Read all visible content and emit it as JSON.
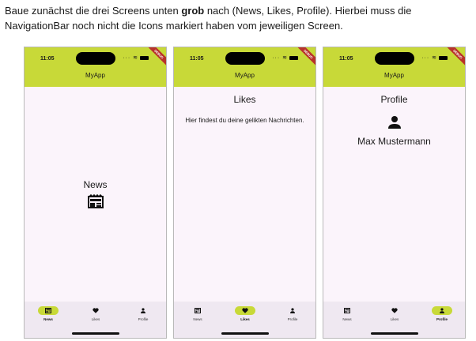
{
  "instruction": {
    "part1": "Baue zunächst die drei Screens unten ",
    "bold": "grob",
    "part2": " nach (News, Likes, Profile). Hierbei muss die NavigationBar noch nicht die Icons markiert haben vom jeweiligen Screen."
  },
  "phones": [
    {
      "status_time": "11:05",
      "debug_banner": "DEBUG",
      "app_title": "MyApp",
      "screen_title": "News",
      "screen_icon": "newspaper-icon",
      "nav": [
        {
          "label": "News",
          "icon": "newspaper-icon",
          "active": true
        },
        {
          "label": "Likes",
          "icon": "heart-icon",
          "active": false
        },
        {
          "label": "Profile",
          "icon": "person-icon",
          "active": false
        }
      ]
    },
    {
      "status_time": "11:05",
      "debug_banner": "DEBUG",
      "app_title": "MyApp",
      "screen_title": "Likes",
      "screen_text": "Hier findest du deine gelikten Nachrichten.",
      "nav": [
        {
          "label": "News",
          "icon": "newspaper-icon",
          "active": false
        },
        {
          "label": "Likes",
          "icon": "heart-icon",
          "active": true
        },
        {
          "label": "Profile",
          "icon": "person-icon",
          "active": false
        }
      ]
    },
    {
      "status_time": "11:05",
      "debug_banner": "DEBUG",
      "app_title": "MyApp",
      "screen_title": "Profile",
      "screen_icon": "person-icon",
      "profile_name": "Max Mustermann",
      "nav": [
        {
          "label": "News",
          "icon": "newspaper-icon",
          "active": false
        },
        {
          "label": "Likes",
          "icon": "heart-icon",
          "active": false
        },
        {
          "label": "Profile",
          "icon": "person-icon",
          "active": true
        }
      ]
    }
  ],
  "colors": {
    "appbar": "#c8d938",
    "background": "#fbf4fb",
    "navbar": "#efe8f1",
    "debug_banner": "#b8322a"
  }
}
